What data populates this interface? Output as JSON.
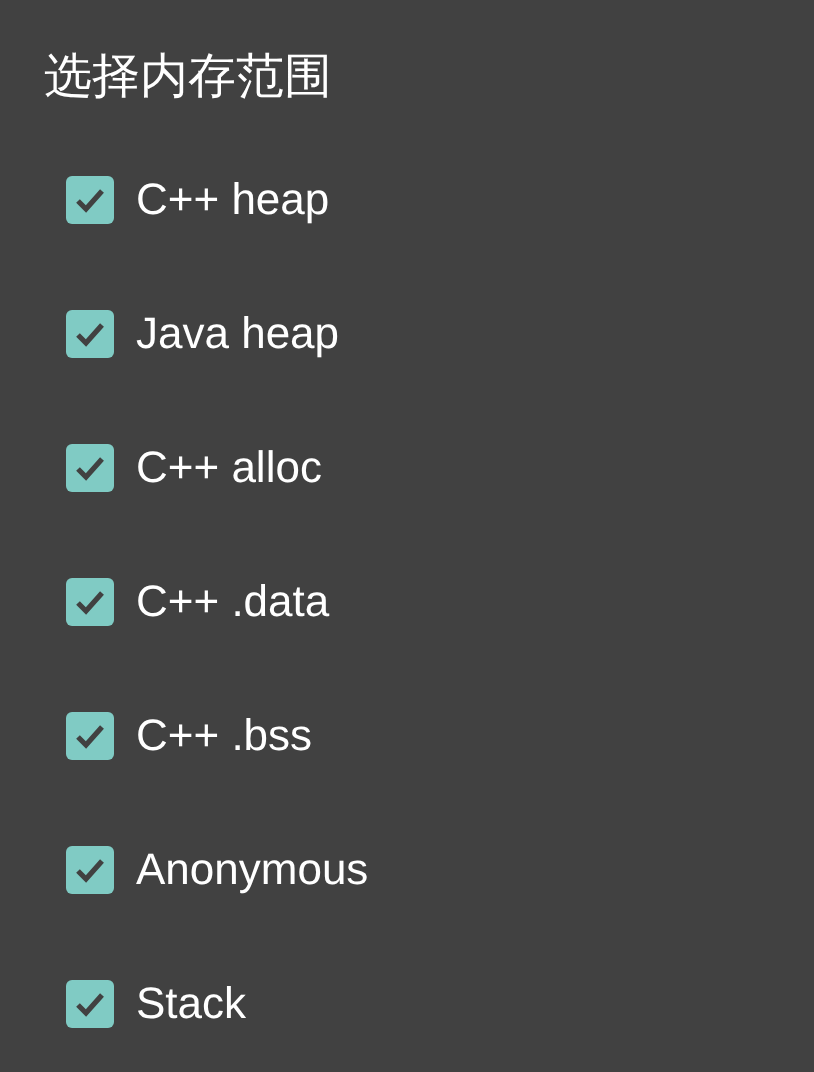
{
  "title": "选择内存范围",
  "options": [
    {
      "label": "C++ heap",
      "checked": true
    },
    {
      "label": "Java heap",
      "checked": true
    },
    {
      "label": "C++ alloc",
      "checked": true
    },
    {
      "label": "C++ .data",
      "checked": true
    },
    {
      "label": "C++ .bss",
      "checked": true
    },
    {
      "label": "Anonymous",
      "checked": true
    },
    {
      "label": "Stack",
      "checked": true
    }
  ]
}
